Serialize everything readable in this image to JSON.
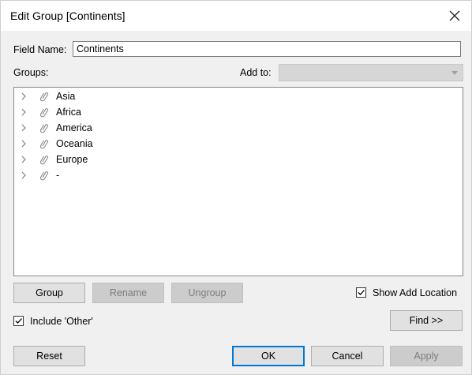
{
  "window": {
    "title": "Edit Group [Continents]"
  },
  "field_name": {
    "label": "Field Name:",
    "value": "Continents"
  },
  "groups_label": "Groups:",
  "add_to": {
    "label": "Add to:",
    "value": ""
  },
  "tree_items": [
    {
      "label": "Asia"
    },
    {
      "label": "Africa"
    },
    {
      "label": "America"
    },
    {
      "label": "Oceania"
    },
    {
      "label": "Europe"
    },
    {
      "label": "-"
    }
  ],
  "buttons": {
    "group": "Group",
    "rename": "Rename",
    "ungroup": "Ungroup",
    "find": "Find >>",
    "reset": "Reset",
    "ok": "OK",
    "cancel": "Cancel",
    "apply": "Apply"
  },
  "checkboxes": {
    "show_add_location": {
      "label": "Show Add Location",
      "checked": true
    },
    "include_other": {
      "label": "Include 'Other'",
      "checked": true
    }
  },
  "colors": {
    "accent": "#0078d7",
    "dialog_bg": "#f0f0f0",
    "disabled_bg": "#cccccc"
  }
}
